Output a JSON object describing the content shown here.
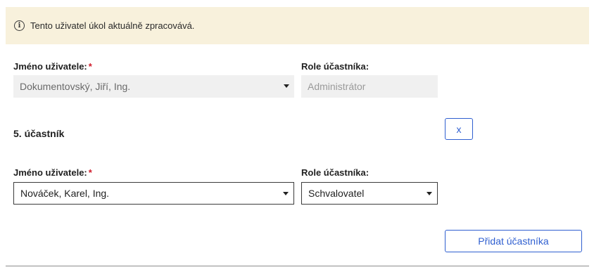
{
  "banner": {
    "icon": "info-icon",
    "text": "Tento uživatel úkol aktuálně zpracovává."
  },
  "participant_current": {
    "user_label": "Jméno uživatele:",
    "required_mark": "*",
    "user_value": "Dokumentovský, Jiří, Ing.",
    "role_label": "Role účastníka:",
    "role_value": "Administrátor"
  },
  "participant_5": {
    "title": "5. účastník",
    "remove_label": "x",
    "user_label": "Jméno uživatele:",
    "required_mark": "*",
    "user_value": "Nováček, Karel, Ing.",
    "role_label": "Role účastníka:",
    "role_value": "Schvalovatel"
  },
  "actions": {
    "add_participant_label": "Přidat účastníka"
  },
  "colors": {
    "banner_bg": "#f8f1dc",
    "accent": "#2f5fd0",
    "required": "#d01c2b"
  }
}
